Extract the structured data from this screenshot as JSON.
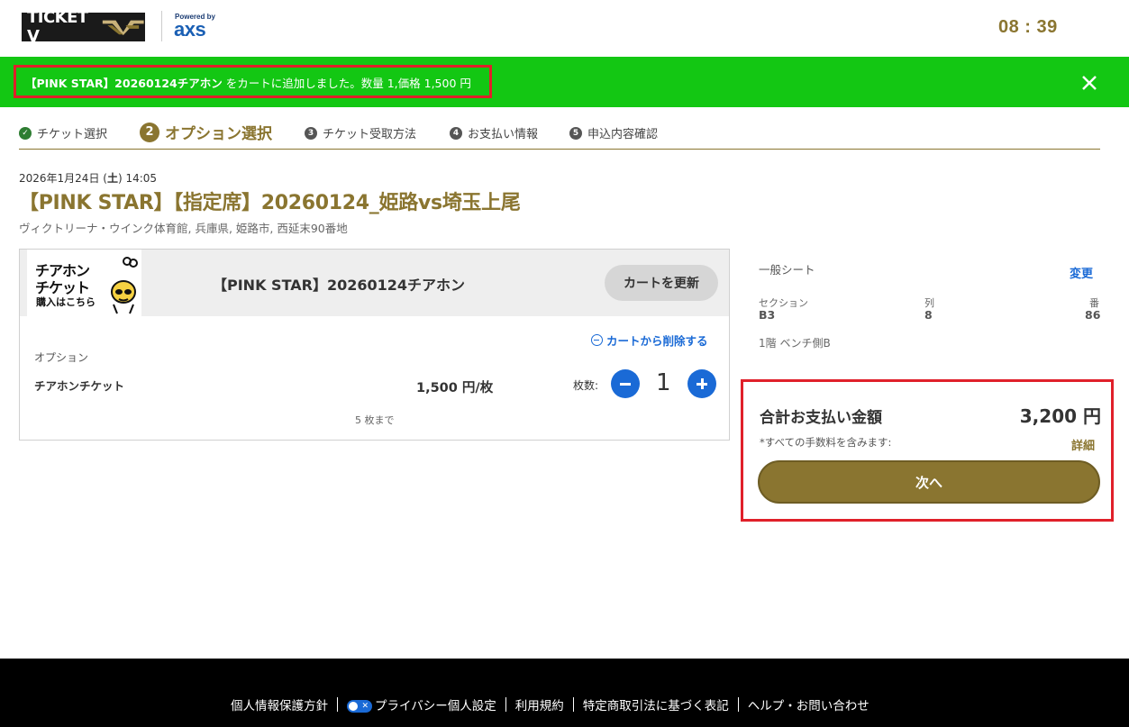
{
  "header": {
    "logo_text": "TICKET V",
    "powered_by": "Powered by",
    "partner": "axs",
    "timer": "08 : 39"
  },
  "banner": {
    "product": "【PINK STAR】20260124チアホン",
    "message": " をカートに追加しました。数量 1,価格 1,500 円",
    "close_icon": "close-icon"
  },
  "steps": [
    {
      "num": "✓",
      "label": "チケット選択",
      "state": "done"
    },
    {
      "num": "2",
      "label": "オプション選択",
      "state": "active"
    },
    {
      "num": "3",
      "label": "チケット受取方法",
      "state": "pending"
    },
    {
      "num": "4",
      "label": "お支払い情報",
      "state": "pending"
    },
    {
      "num": "5",
      "label": "申込内容確認",
      "state": "pending"
    }
  ],
  "event": {
    "date_prefix": "2026年1月24日 (",
    "weekday": "土",
    "date_suffix": ") 14:05",
    "title": "【PINK STAR】【指定席】20260124_姫路vs埼玉上尾",
    "venue": "ヴィクトリーナ・ウインク体育館, 兵庫県, 姫路市, 西延末90番地"
  },
  "cart": {
    "thumb_line1": "チアホン",
    "thumb_line2": "チケット",
    "thumb_line3": "購入はこちら",
    "product_name": "【PINK STAR】20260124チアホン",
    "update_button": "カートを更新",
    "remove_link": "カートから削除する",
    "option_label": "オプション",
    "option_name": "チアホンチケット",
    "price": "1,500 円/枚",
    "qty_label": "枚数:",
    "quantity": "1",
    "limit": "5 枚まで"
  },
  "seat": {
    "type": "一般シート",
    "change_link": "変更",
    "section_label": "セクション",
    "section_value": "B3",
    "row_label": "列",
    "row_value": "8",
    "number_label": "番",
    "number_value": "86",
    "note": "1階 ベンチ側B"
  },
  "total": {
    "label": "合計お支払い金額",
    "amount": "3,200 円",
    "fees_note": "*すべての手数料を含みます:",
    "detail_link": "詳細",
    "next_button": "次へ"
  },
  "footer": {
    "links": [
      "個人情報保護方針",
      "プライバシー個人設定",
      "利用規約",
      "特定商取引法に基づく表記",
      "ヘルプ・お問い合わせ"
    ]
  },
  "colors": {
    "brand_gold": "#8a7530",
    "banner_green": "#13c713",
    "link_blue": "#1a6ad6",
    "highlight_red": "#e0202a"
  }
}
